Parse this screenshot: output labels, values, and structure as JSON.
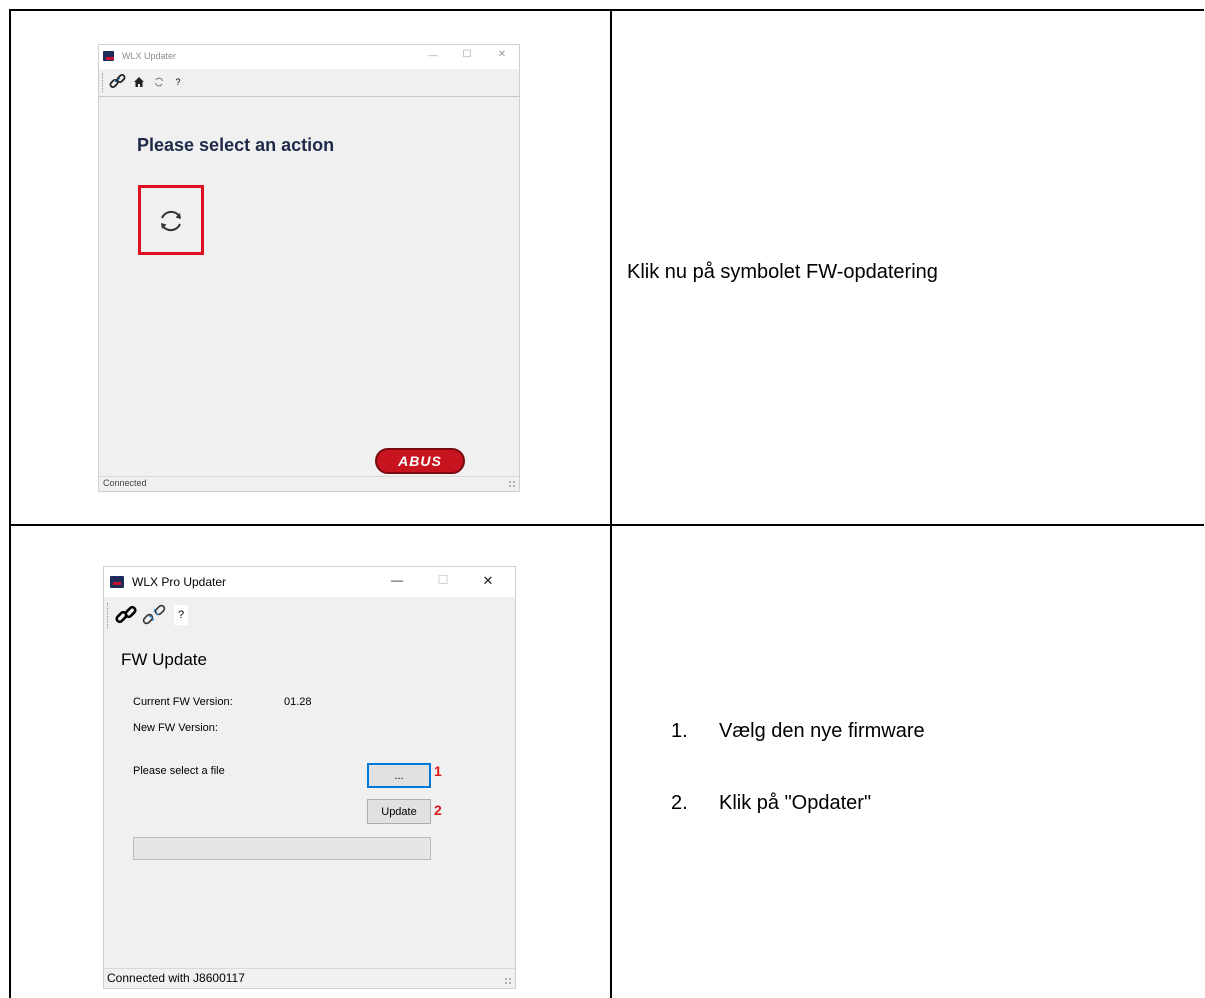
{
  "row1": {
    "window": {
      "title": "WLX Updater",
      "controls": {
        "minimize": "—",
        "maximize": "☐",
        "close": "✕"
      },
      "toolbar": [
        "link-icon",
        "home-icon",
        "refresh-icon",
        "help"
      ],
      "toolbar_help": "?",
      "heading": "Please select an action",
      "action": "fw-update-icon",
      "logo_text": "ABUS",
      "status": "Connected"
    },
    "instruction": "Klik nu på symbolet FW-opdatering"
  },
  "row2": {
    "window": {
      "title": "WLX Pro Updater",
      "controls": {
        "minimize": "—",
        "maximize": "☐",
        "close": "✕"
      },
      "toolbar": [
        "connect-icon",
        "disconnect-icon",
        "help"
      ],
      "toolbar_help": "?",
      "heading": "FW Update",
      "current_fw_label": "Current FW Version:",
      "current_fw_value": "01.28",
      "new_fw_label": "New FW Version:",
      "select_file_label": "Please select a file",
      "browse_button": "...",
      "update_button": "Update",
      "marker1": "1",
      "marker2": "2",
      "progress": 0,
      "status": "Connected with J8600117"
    },
    "steps": [
      {
        "num": "1.",
        "text": "Vælg den nye firmware"
      },
      {
        "num": "2.",
        "text": "Klik på \"Opdater\""
      }
    ]
  },
  "colors": {
    "highlight": "#e01020",
    "marker": "#d81a1a",
    "heading": "#1f2a4a",
    "focus": "#0078d7",
    "abus_red": "#c8141e"
  }
}
